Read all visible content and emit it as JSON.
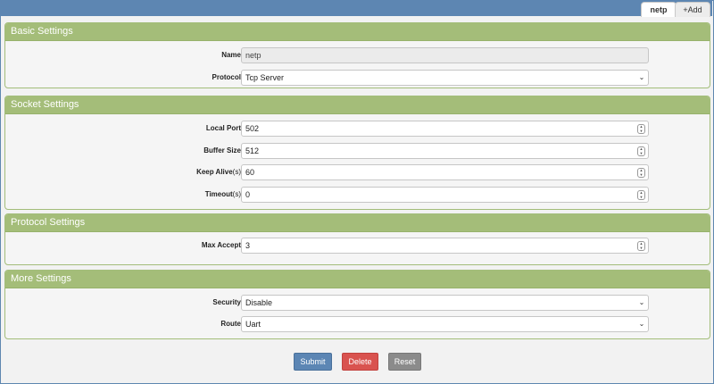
{
  "tabs": {
    "active": "netp",
    "add": "+Add"
  },
  "basic": {
    "title": "Basic Settings",
    "name_label": "Name",
    "name_value": "netp",
    "protocol_label": "Protocol",
    "protocol_value": "Tcp Server"
  },
  "socket": {
    "title": "Socket Settings",
    "local_port_label": "Local Port",
    "local_port_value": "502",
    "buffer_size_label": "Buffer Size",
    "buffer_size_value": "512",
    "keep_alive_label": "Keep Alive",
    "keep_alive_unit": "(s)",
    "keep_alive_value": "60",
    "timeout_label": "Timeout",
    "timeout_unit": "(s)",
    "timeout_value": "0"
  },
  "protocol": {
    "title": "Protocol Settings",
    "max_accept_label": "Max Accept",
    "max_accept_value": "3"
  },
  "more": {
    "title": "More Settings",
    "security_label": "Security",
    "security_value": "Disable",
    "route_label": "Route",
    "route_value": "Uart"
  },
  "buttons": {
    "submit": "Submit",
    "delete": "Delete",
    "reset": "Reset"
  },
  "colors": {
    "topbar": "#5d86b2",
    "panel_header": "#a4bd79",
    "submit": "#5c86b4",
    "delete": "#d9534f",
    "reset": "#8b8b8b"
  }
}
